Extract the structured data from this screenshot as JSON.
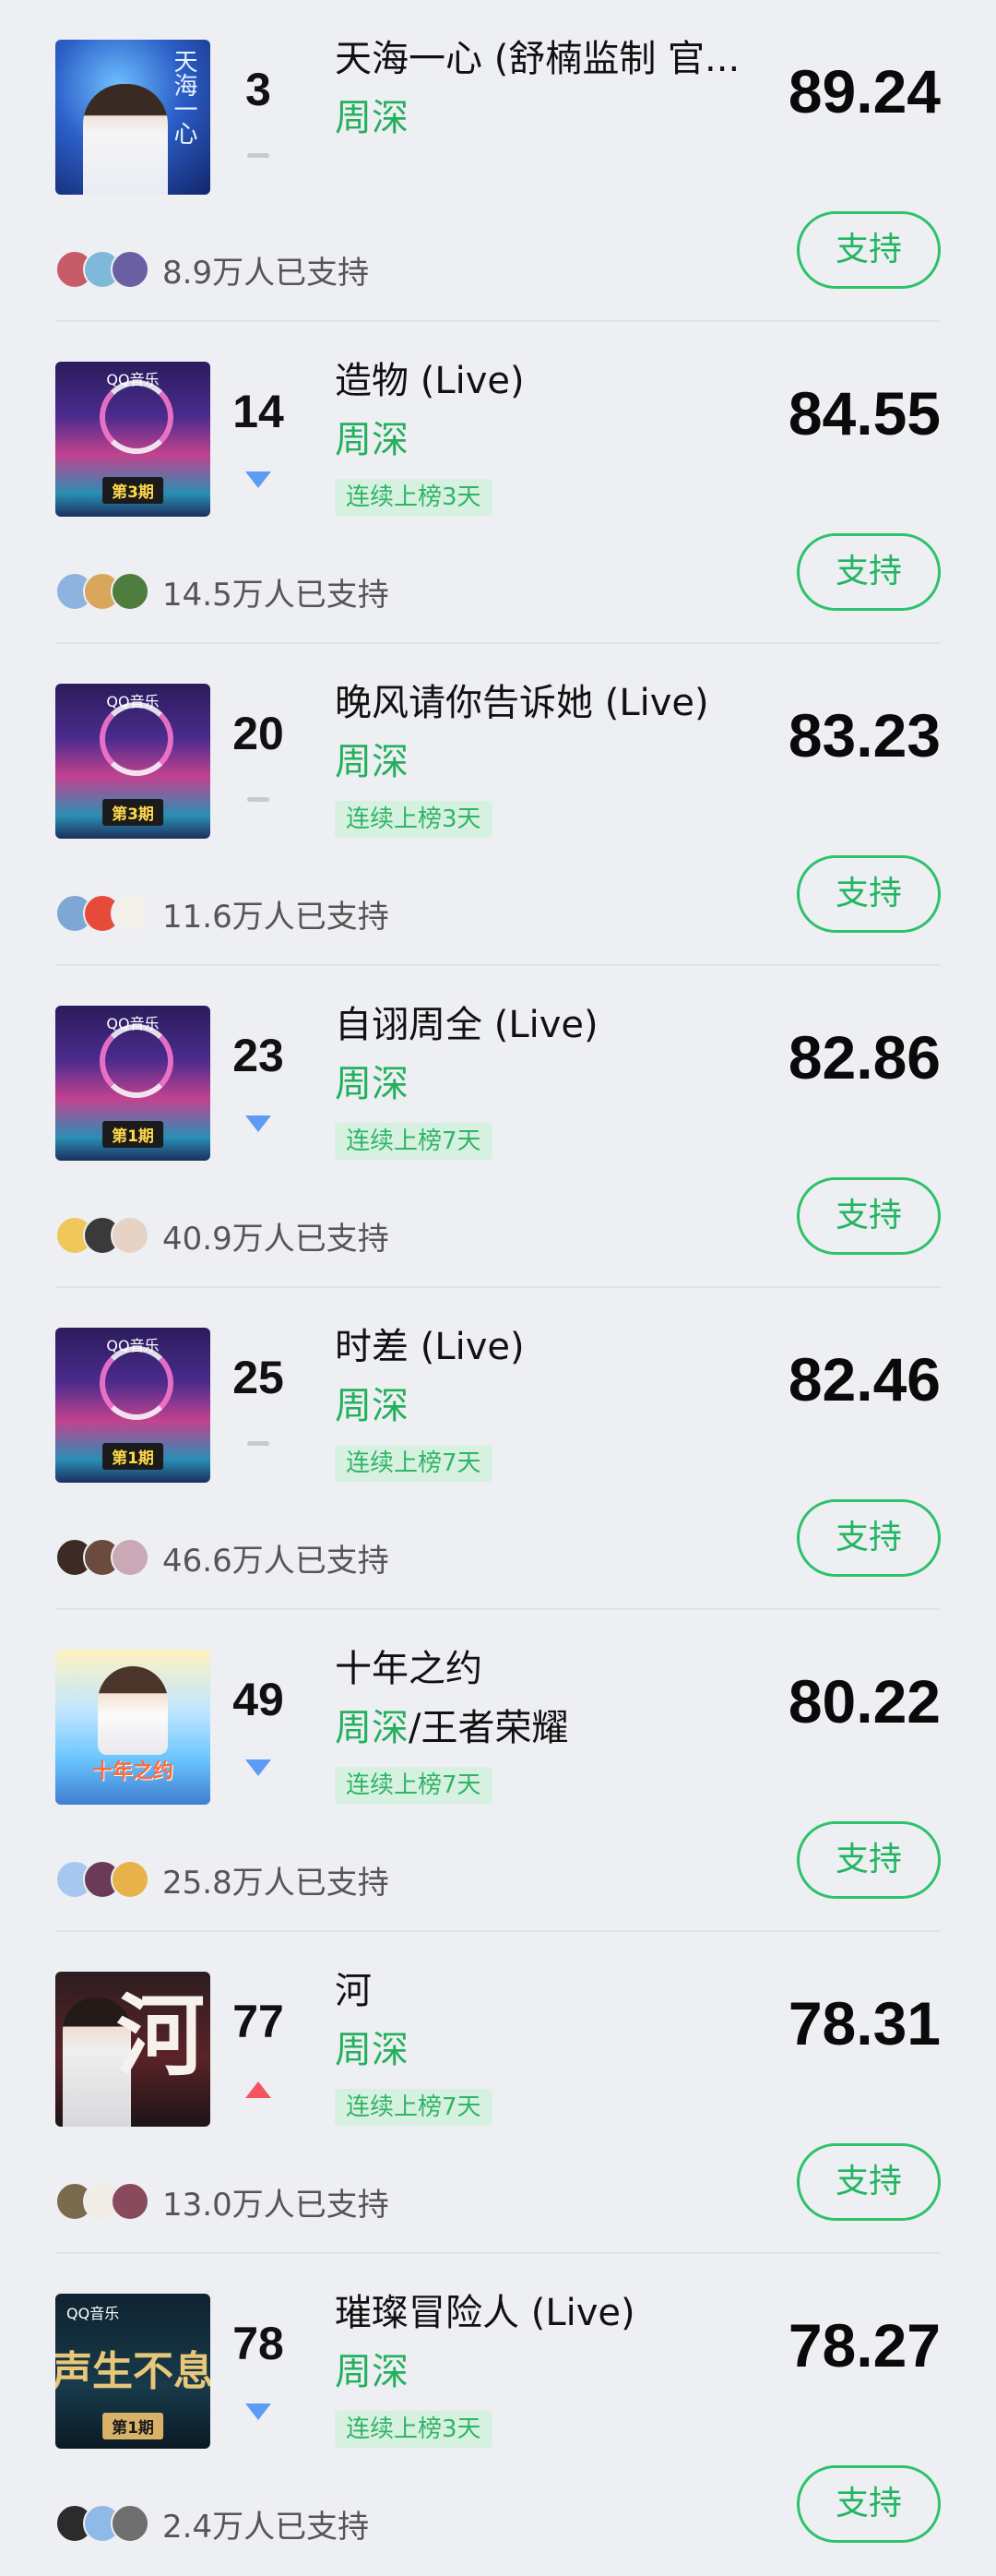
{
  "support_label": "支持",
  "items": [
    {
      "rank": "3",
      "trend": "same",
      "title": "天海一心 (舒楠监制 官...",
      "artist": "周深",
      "artist2": "",
      "tag": "",
      "score": "89.24",
      "supporters": "8.9万人已支持",
      "cover": "sky",
      "cover_text": "天海一心",
      "avatars": [
        "#c75b68",
        "#7fb8d8",
        "#6b5fa3"
      ]
    },
    {
      "rank": "14",
      "trend": "down",
      "title": "造物 (Live)",
      "artist": "周深",
      "artist2": "",
      "tag": "连续上榜3天",
      "score": "84.55",
      "supporters": "14.5万人已支持",
      "cover": "qq",
      "cover_badge": "第3期",
      "avatars": [
        "#8fb3e0",
        "#d9a65c",
        "#4f7d3d"
      ]
    },
    {
      "rank": "20",
      "trend": "same",
      "title": "晚风请你告诉她 (Live)",
      "artist": "周深",
      "artist2": "",
      "tag": "连续上榜3天",
      "score": "83.23",
      "supporters": "11.6万人已支持",
      "cover": "qq",
      "cover_badge": "第3期",
      "avatars": [
        "#7ea7d6",
        "#e64b3a",
        "#f3f0ea"
      ]
    },
    {
      "rank": "23",
      "trend": "down",
      "title": "自诩周全 (Live)",
      "artist": "周深",
      "artist2": "",
      "tag": "连续上榜7天",
      "score": "82.86",
      "supporters": "40.9万人已支持",
      "cover": "qq",
      "cover_badge": "第1期",
      "avatars": [
        "#f0c75a",
        "#3a3a3a",
        "#e7d2c6"
      ]
    },
    {
      "rank": "25",
      "trend": "same",
      "title": "时差 (Live)",
      "artist": "周深",
      "artist2": "",
      "tag": "连续上榜7天",
      "score": "82.46",
      "supporters": "46.6万人已支持",
      "cover": "qq",
      "cover_badge": "第1期",
      "avatars": [
        "#3b2b24",
        "#6b4b3e",
        "#c9a9b6"
      ]
    },
    {
      "rank": "49",
      "trend": "down",
      "title": "十年之约",
      "artist": "周深",
      "artist2": "王者荣耀",
      "tag": "连续上榜7天",
      "score": "80.22",
      "supporters": "25.8万人已支持",
      "cover": "ten",
      "cover_text": "十年之约",
      "avatars": [
        "#a6c8ef",
        "#6a3a58",
        "#e8b24a"
      ]
    },
    {
      "rank": "77",
      "trend": "up",
      "title": "河",
      "artist": "周深",
      "artist2": "",
      "tag": "连续上榜7天",
      "score": "78.31",
      "supporters": "13.0万人已支持",
      "cover": "he",
      "cover_text": "河",
      "avatars": [
        "#7a6a4e",
        "#f1ece4",
        "#8a4a5e"
      ]
    },
    {
      "rank": "78",
      "trend": "down",
      "title": "璀璨冒险人 (Live)",
      "artist": "周深",
      "artist2": "",
      "tag": "连续上榜3天",
      "score": "78.27",
      "supporters": "2.4万人已支持",
      "cover": "dark",
      "cover_badge": "第1期",
      "cover_text": "声生不息",
      "avatars": [
        "#2b2b2b",
        "#8fb9e6",
        "#6f6f6f"
      ]
    }
  ],
  "cover_brand": "QQ音乐"
}
